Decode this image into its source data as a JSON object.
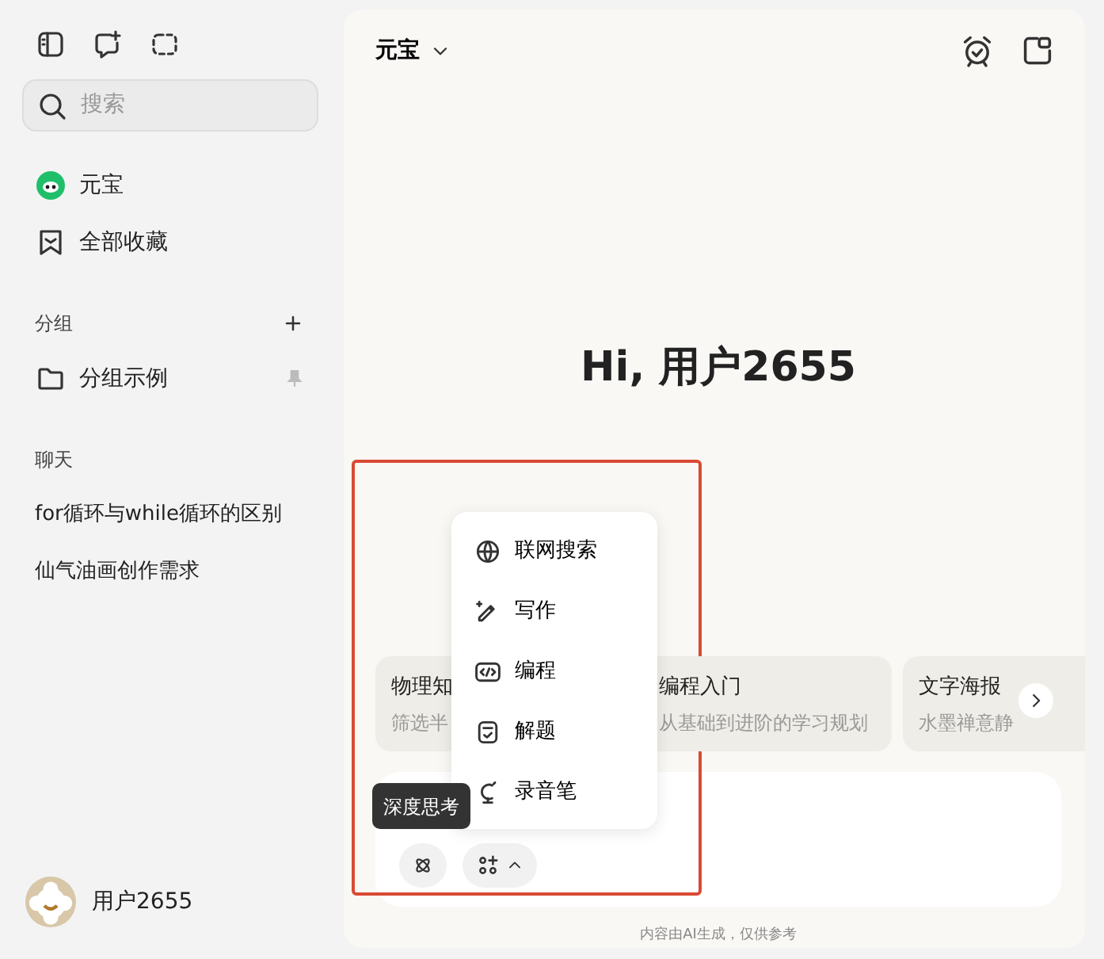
{
  "sidebar": {
    "search": {
      "placeholder": "搜索"
    },
    "nav": [
      {
        "label": "元宝",
        "kind": "bot"
      },
      {
        "label": "全部收藏",
        "kind": "bookmark"
      }
    ],
    "groups_header": "分组",
    "groups": [
      {
        "label": "分组示例"
      }
    ],
    "chats_header": "聊天",
    "chats": [
      {
        "label": "for循环与while循环的区别"
      },
      {
        "label": "仙气油画创作需求"
      }
    ],
    "user": {
      "name": "用户2655"
    }
  },
  "main": {
    "model": "元宝",
    "greeting": "Hi, 用户2655",
    "suggestions": [
      {
        "title": "物理知",
        "subtitle": "筛选半"
      },
      {
        "title": "编程入门",
        "subtitle": "从基础到进阶的学习规划"
      },
      {
        "title": "文字海报",
        "subtitle": "水墨禅意静"
      }
    ],
    "tools_menu": [
      {
        "label": "联网搜索",
        "kind": "globe"
      },
      {
        "label": "写作",
        "kind": "pen"
      },
      {
        "label": "编程",
        "kind": "code"
      },
      {
        "label": "解题",
        "kind": "check"
      },
      {
        "label": "录音笔",
        "kind": "mic"
      }
    ],
    "tooltip": "深度思考",
    "disclaimer": "内容由AI生成，仅供参考"
  }
}
